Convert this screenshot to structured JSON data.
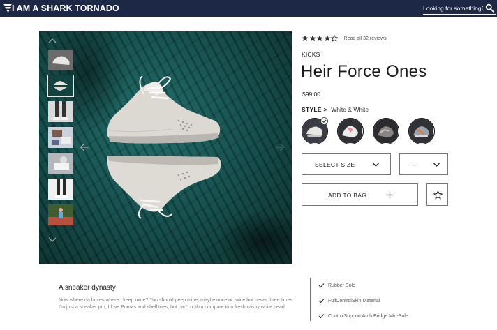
{
  "header": {
    "brand": "I AM A SHARK TORNADO",
    "search_placeholder": "Looking for something?",
    "logo_icon": "tornado-logo-icon",
    "search_icon": "search-icon"
  },
  "gallery": {
    "thumbnails": [
      "sneaker-top-view",
      "sneaker-pair-reflection",
      "legs-in-sneakers",
      "sneakers-on-feet",
      "person-sitting-sneakers",
      "legs-standing",
      "runner-on-track"
    ],
    "active_thumbnail": 1,
    "prev_icon": "arrow-left-icon",
    "next_icon": "arrow-right-icon",
    "up_icon": "chevron-up-icon",
    "down_icon": "chevron-down-icon"
  },
  "product": {
    "rating": 4,
    "rating_max": 5,
    "reviews_text": "Read all 32 reviews",
    "category": "KICKS",
    "name": "Heir Force Ones",
    "price": "$99.00",
    "style_label": "STYLE >",
    "style_value": "White & White",
    "swatches": [
      "white-white",
      "white-pink",
      "grey-brown",
      "grey-orange"
    ],
    "selected_swatch": 0
  },
  "actions": {
    "size_label": "SELECT SIZE",
    "qty_label": "---",
    "add_label": "ADD TO BAG",
    "add_icon": "plus-icon",
    "wishlist_icon": "star-icon"
  },
  "description": {
    "title": "A sneaker dynasty",
    "body": "Now where da boxes where I keep mine? You should peep mine, maybe once or twice but never three times. I'm just a sneaker pro, I love Pumas and shell toes, but can't nothin compare to a fresh crispy white pearl",
    "features": [
      "Rubber Sole",
      "FullControlSkin Material",
      "ControlSupport Arch Bridge Mid-Sole"
    ]
  },
  "colors": {
    "header_bg": "#1d2847",
    "backdrop": "#0f4846",
    "text_dark": "#222222"
  }
}
